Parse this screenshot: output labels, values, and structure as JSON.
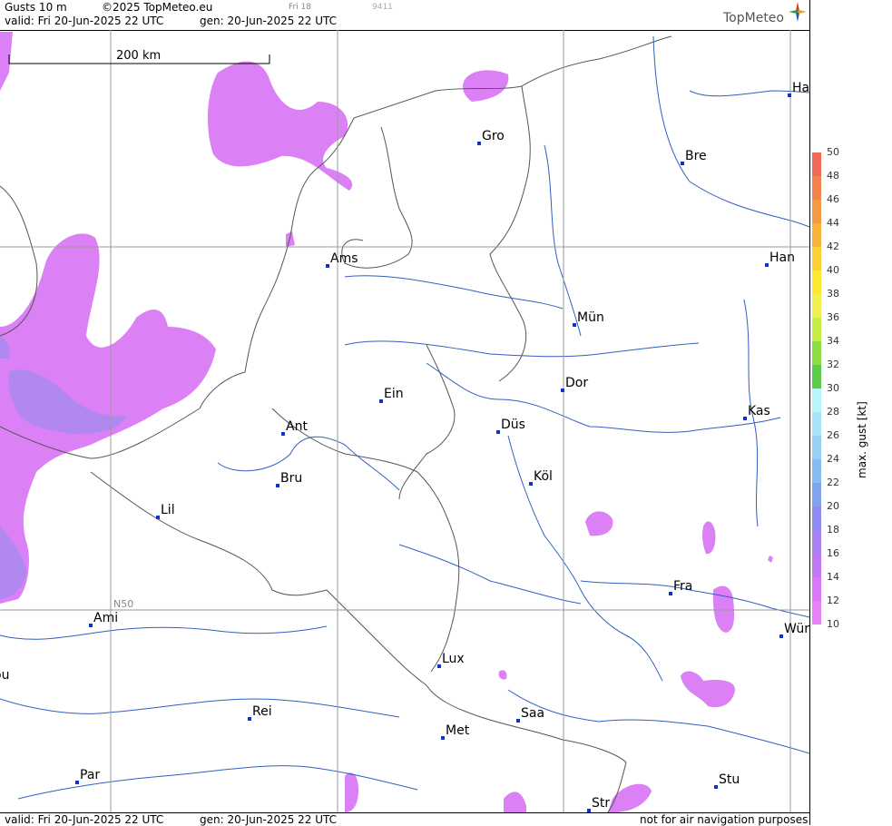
{
  "header": {
    "product": "Gusts 10 m",
    "copyright": "©2025 TopMeteo.eu",
    "valid": "valid:  Fri  20-Jun-2025  22 UTC",
    "gen": "gen: 20-Jun-2025 22 UTC",
    "small_time": "Fri 18",
    "small_code": "9411",
    "brand": "TopMeteo"
  },
  "footer": {
    "valid": "valid:  Fri  20-Jun-2025  22 UTC",
    "gen": "gen: 20-Jun-2025 22 UTC",
    "note": "not for air navigation purposes"
  },
  "map": {
    "scale_label": "200 km",
    "gridline_label": "N50",
    "cities": [
      {
        "name": "Gro"
      },
      {
        "name": "Bre"
      },
      {
        "name": "Ha"
      },
      {
        "name": "Ams"
      },
      {
        "name": "Han"
      },
      {
        "name": "Mün"
      },
      {
        "name": "Ein"
      },
      {
        "name": "Dor"
      },
      {
        "name": "Ant"
      },
      {
        "name": "Düs"
      },
      {
        "name": "Kas"
      },
      {
        "name": "Bru"
      },
      {
        "name": "Köl"
      },
      {
        "name": "Lil"
      },
      {
        "name": "Ami"
      },
      {
        "name": "Fra"
      },
      {
        "name": "Wür"
      },
      {
        "name": "Lux"
      },
      {
        "name": "ou"
      },
      {
        "name": "Rei"
      },
      {
        "name": "Saa"
      },
      {
        "name": "Met"
      },
      {
        "name": "Par"
      },
      {
        "name": "Stu"
      },
      {
        "name": "Str"
      }
    ]
  },
  "legend": {
    "title": "max. gust [kt]",
    "labels": [
      "50",
      "48",
      "46",
      "44",
      "42",
      "40",
      "38",
      "36",
      "34",
      "32",
      "30",
      "28",
      "26",
      "24",
      "22",
      "20",
      "18",
      "16",
      "14",
      "12",
      "10"
    ],
    "colors": [
      "#f06a5a",
      "#f4824e",
      "#f59a44",
      "#f8b23a",
      "#fbd033",
      "#fde830",
      "#f2f050",
      "#c6ec46",
      "#8edc44",
      "#5acc4a",
      "#b8f4f8",
      "#a8e4f8",
      "#98d0f4",
      "#88bcf0",
      "#80a4ec",
      "#8c8cf0",
      "#a880f0",
      "#c078f2",
      "#d878f6",
      "#e880f8",
      "#ffffff"
    ]
  }
}
